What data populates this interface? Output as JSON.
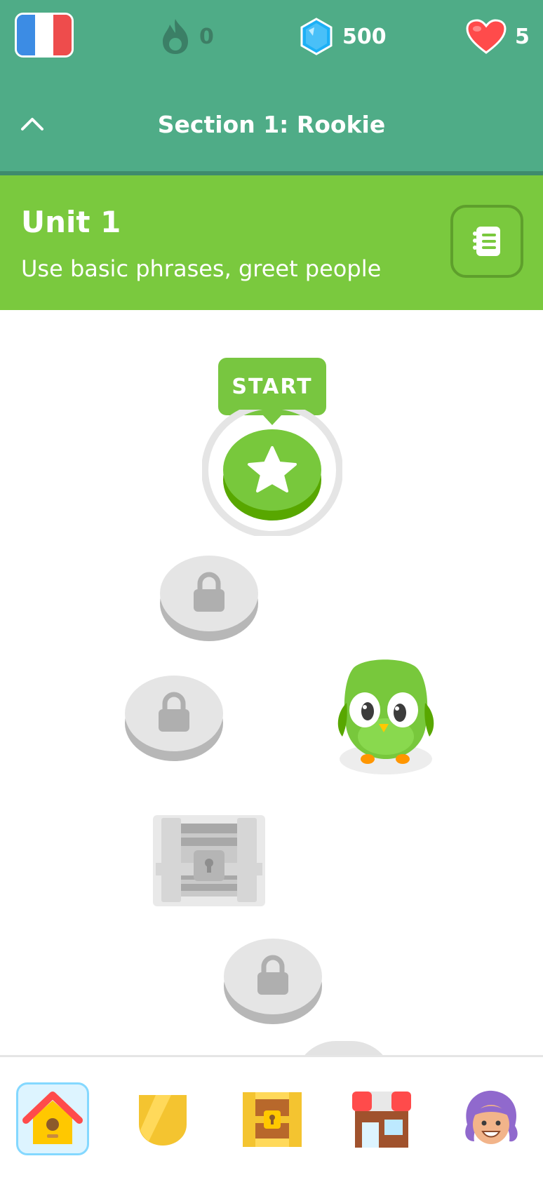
{
  "top_bar": {
    "course_flag": "french-flag-icon",
    "streak": {
      "icon": "flame-icon",
      "value": "0"
    },
    "gems": {
      "icon": "gem-icon",
      "value": "500"
    },
    "hearts": {
      "icon": "heart-icon",
      "value": "5"
    }
  },
  "section": {
    "title": "Section 1: Rookie",
    "toggle_icon": "chevron-up-icon"
  },
  "unit": {
    "title": "Unit 1",
    "description": "Use basic phrases, greet people",
    "guidebook_icon": "guidebook-icon"
  },
  "path": {
    "start_label": "START",
    "nodes": [
      {
        "type": "lesson",
        "state": "current",
        "icon": "star-icon"
      },
      {
        "type": "lesson",
        "state": "locked",
        "icon": "lock-icon"
      },
      {
        "type": "lesson",
        "state": "locked",
        "icon": "lock-icon"
      },
      {
        "type": "chest",
        "state": "locked",
        "icon": "chest-icon"
      },
      {
        "type": "lesson",
        "state": "locked",
        "icon": "lock-icon"
      }
    ],
    "mascot": "owl-mascot"
  },
  "bottom_nav": [
    {
      "name": "learn",
      "icon": "home-icon",
      "active": true
    },
    {
      "name": "leaderboards",
      "icon": "shield-icon",
      "active": false
    },
    {
      "name": "quests",
      "icon": "treasure-chest-icon",
      "active": false
    },
    {
      "name": "shop",
      "icon": "shop-icon",
      "active": false
    },
    {
      "name": "profile",
      "icon": "avatar-icon",
      "active": false
    }
  ],
  "colors": {
    "top_bar": "#4FAC87",
    "unit_header": "#7AC93E",
    "locked_node": "#E5E5E5",
    "nav_active_bg": "#DDF4FF",
    "nav_active_border": "#84D8FF"
  }
}
